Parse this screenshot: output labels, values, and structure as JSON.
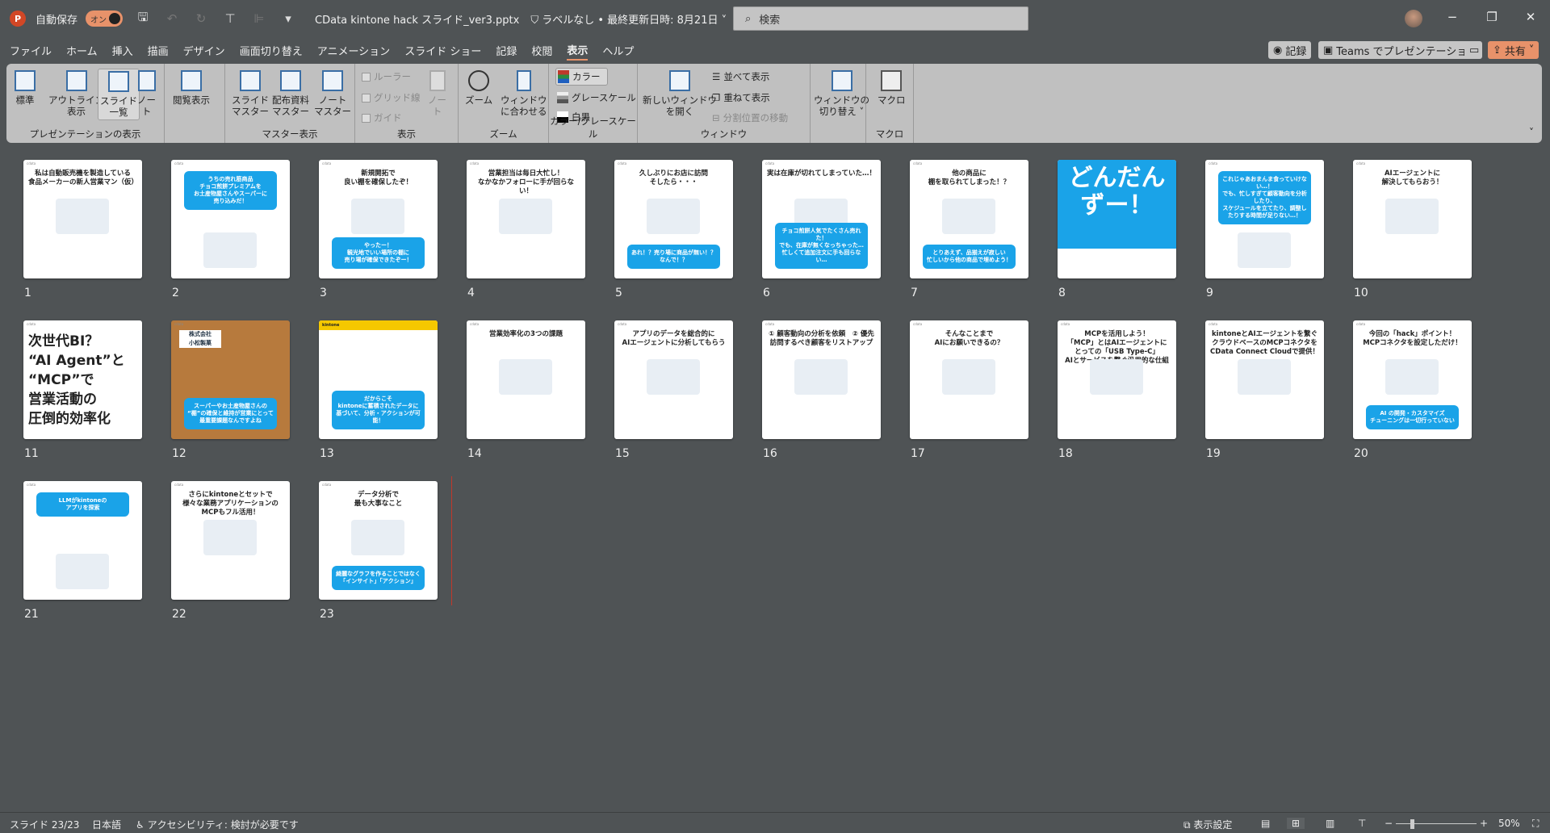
{
  "titlebar": {
    "app_icon": "P",
    "autosave_label": "自動保存",
    "autosave_state": "オン",
    "doc_title": "CData kintone hack スライド_ver3.pptx",
    "sensitivity": "ラベルなし • 最終更新日時: 8月21日",
    "search_placeholder": "検索",
    "minimize": "−",
    "restore": "❐",
    "close": "✕"
  },
  "menu": {
    "tabs": [
      "ファイル",
      "ホーム",
      "挿入",
      "描画",
      "デザイン",
      "画面切り替え",
      "アニメーション",
      "スライド ショー",
      "記録",
      "校閲",
      "表示",
      "ヘルプ"
    ],
    "active": "表示",
    "record_btn": "記録",
    "teams_btn": "Teams でプレゼンテーション",
    "share_btn": "共有"
  },
  "ribbon": {
    "groups": {
      "presentation_views": "プレゼンテーションの表示",
      "master_views": "マスター表示",
      "show": "表示",
      "zoom": "ズーム",
      "color": "カラー/グレースケール",
      "window": "ウィンドウ",
      "macro": "マクロ"
    },
    "buttons": {
      "normal": "標準",
      "outline": "アウトライン\n表示",
      "sorter": "スライド\n一覧",
      "notes_page": "ノー\nト",
      "reading": "閲覧表示",
      "slide_master": "スライド\nマスター",
      "handout_master": "配布資料\nマスター",
      "notes_master": "ノート\nマスター",
      "ruler": "ルーラー",
      "gridlines": "グリッド線",
      "guides": "ガイド",
      "notes": "ノー\nト",
      "zoom": "ズーム",
      "fit_window": "ウィンドウ\nに合わせる",
      "color": "カラー",
      "grayscale": "グレースケール",
      "bw": "白黒",
      "new_window": "新しいウィンドウ\nを開く",
      "arrange_all": "並べて表示",
      "cascade": "重ねて表示",
      "move_split": "分割位置の移動",
      "switch_windows": "ウィンドウの\n切り替え ˅",
      "macros": "マクロ"
    }
  },
  "slides": [
    {
      "n": "1",
      "title": "私は自動販売機を製造している\n食品メーカーの新人営業マン（仮）",
      "callout": "",
      "style": "normal"
    },
    {
      "n": "2",
      "title": "",
      "callout": "うちの売れ筋商品\nチョコ煎餅プレミアムを\nお土産物屋さんやスーパーに\n売り込みだ！",
      "style": "top"
    },
    {
      "n": "3",
      "title": "新規開拓で\n良い棚を確保したぞ！",
      "callout": "やったー！\n観光地でいい場所の棚に\n売り場が確保できたぞー！",
      "style": "normal"
    },
    {
      "n": "4",
      "title": "営業担当は毎日大忙し！\nなかなかフォローに手が回らない！",
      "callout": "",
      "style": "normal"
    },
    {
      "n": "5",
      "title": "久しぶりにお店に訪問\nそしたら・・・",
      "callout": "あれ！？売り場に商品が無い！？\nなんで！？",
      "style": "normal"
    },
    {
      "n": "6",
      "title": "実は在庫が切れてしまっていた…！",
      "callout": "チョコ煎餅人気でたくさん売れた！\nでも、在庫が無くなっちゃった…\n忙しくて追加注文に手も回らない…",
      "style": "normal"
    },
    {
      "n": "7",
      "title": "他の商品に\n棚を取られてしまった！？",
      "callout": "とりあえず、品揃えが寂しい\n忙しいから他の商品で埋めよう！",
      "style": "normal"
    },
    {
      "n": "8",
      "title": "どんだん\nずー！",
      "callout": "",
      "style": "blue"
    },
    {
      "n": "9",
      "title": "",
      "callout": "これじゃあおまんま食っていけない…！\nでも、忙しすぎて顧客動向を分析したり、\nスケジュールを立てたり、調整したりする時間が足りない…！",
      "style": "top"
    },
    {
      "n": "10",
      "title": "AIエージェントに\n解決してもらおう！",
      "callout": "",
      "style": "normal"
    },
    {
      "n": "11",
      "title": "次世代BI？\n“AI Agent”と\n“MCP”で\n営業活動の\n圧倒的効率化",
      "callout": "",
      "style": "big"
    },
    {
      "n": "12",
      "title": "株式会社\n小松製菓",
      "callout": "スーパーやお土産物屋さんの\n“棚”の確保と維持が営業にとって\n最重要課題なんですよね",
      "style": "photo"
    },
    {
      "n": "13",
      "title": "kintone",
      "callout": "だからこそ\nkintoneに蓄積されたデータに\n基づいて、分析・アクションが可能！",
      "style": "ui"
    },
    {
      "n": "14",
      "title": "営業効率化の3つの課題",
      "callout": "",
      "style": "normal"
    },
    {
      "n": "15",
      "title": "アプリのデータを総合的に\nAIエージェントに分析してもらう",
      "callout": "",
      "style": "normal"
    },
    {
      "n": "16",
      "title": "① 顧客動向の分析を依頼　② 優先訪問するべき顧客をリストアップ",
      "callout": "",
      "style": "normal"
    },
    {
      "n": "17",
      "title": "そんなことまで\nAIにお願いできるの？",
      "callout": "",
      "style": "normal"
    },
    {
      "n": "18",
      "title": "MCPを活用しよう！\n「MCP」とはAIエージェントに\nとっての「USB Type-C」\nAIとサービスを繋ぐ汎用的な仕組み",
      "callout": "",
      "style": "normal"
    },
    {
      "n": "19",
      "title": "kintoneとAIエージェントを繋ぐ\nクラウドベースのMCPコネクタを\nCData Connect Cloudで提供！",
      "callout": "",
      "style": "normal"
    },
    {
      "n": "20",
      "title": "今回の「hack」ポイント！\nMCPコネクタを設定しただけ！",
      "callout": "AI の開発・カスタマイズ\nチューニングは一切行っていない",
      "style": "normal"
    },
    {
      "n": "21",
      "title": "",
      "callout": "LLMがkintoneの\nアプリを探索",
      "style": "top"
    },
    {
      "n": "22",
      "title": "さらにkintoneとセットで\n様々な業務アプリケーションの\nMCPもフル活用！",
      "callout": "",
      "style": "normal"
    },
    {
      "n": "23",
      "title": "データ分析で\n最も大事なこと",
      "callout": "綺麗なグラフを作ることではなく\n「インサイト」「アクション」",
      "style": "normal"
    }
  ],
  "statusbar": {
    "slide_count": "スライド 23/23",
    "language": "日本語",
    "accessibility": "アクセシビリティ: 検討が必要です",
    "display_settings": "表示設定",
    "zoom_level": "50%",
    "zoom_fraction": 0.5
  },
  "colors": {
    "accent": "#e8926a",
    "callout": "#1aa3e8",
    "insert_marker": "#c0392b"
  }
}
